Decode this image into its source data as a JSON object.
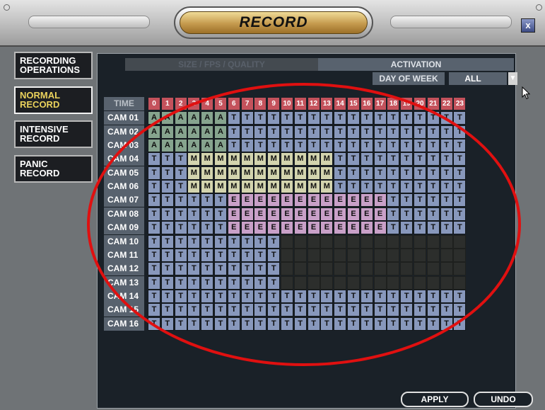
{
  "window": {
    "title": "RECORD",
    "close_label": "x"
  },
  "sidebar": {
    "items": [
      {
        "label": "RECORDING\nOPERATIONS",
        "active": false
      },
      {
        "label": "NORMAL\nRECORD",
        "active": true
      },
      {
        "label": "INTENSIVE\nRECORD",
        "active": false
      },
      {
        "label": "PANIC\nRECORD",
        "active": false
      }
    ]
  },
  "tabs": {
    "size_fps_quality": "SIZE / FPS / QUALITY",
    "activation": "ACTIVATION"
  },
  "day_of_week": {
    "label": "DAY OF WEEK",
    "value": "ALL"
  },
  "schedule": {
    "time_label": "TIME",
    "hours": [
      "0",
      "1",
      "2",
      "3",
      "4",
      "5",
      "6",
      "7",
      "8",
      "9",
      "10",
      "11",
      "12",
      "13",
      "14",
      "15",
      "16",
      "17",
      "18",
      "19",
      "20",
      "21",
      "22",
      "23"
    ],
    "rows": [
      {
        "camera": "CAM 01",
        "cells": "AAAAAATTTTTTTTTTTTTTTTTT"
      },
      {
        "camera": "CAM 02",
        "cells": "AAAAAATTTTTTTTTTTTTTTTTT"
      },
      {
        "camera": "CAM 03",
        "cells": "AAAAAATTTTTTTTTTTTTTTTTT"
      },
      {
        "camera": "CAM 04",
        "cells": "TTTMMMMMMMMMMMTTTTTTTTTT"
      },
      {
        "camera": "CAM 05",
        "cells": "TTTMMMMMMMMMMMTTTTTTTTTT"
      },
      {
        "camera": "CAM 06",
        "cells": "TTTMMMMMMMMMMMTTTTTTTTTT"
      },
      {
        "camera": "CAM 07",
        "cells": "TTTTTTEEEEEEEEEEEETTTTTT"
      },
      {
        "camera": "CAM 08",
        "cells": "TTTTTTEEEEEEEEEEEETTTTTT"
      },
      {
        "camera": "CAM 09",
        "cells": "TTTTTTEEEEEEEEEEEETTTTTT"
      },
      {
        "camera": "CAM 10",
        "cells": "TTTTTTTTTTNNNNNNNNNNNNNN"
      },
      {
        "camera": "CAM 11",
        "cells": "TTTTTTTTTTNNNNNNNNNNNNNN"
      },
      {
        "camera": "CAM 12",
        "cells": "TTTTTTTTTTNNNNNNNNNNNNNN"
      },
      {
        "camera": "CAM 13",
        "cells": "TTTTTTTTTTNNNNNNNNNNNNNN"
      },
      {
        "camera": "CAM 14",
        "cells": "TTTTTTTTTTTTTTTTTTTTTTTT"
      },
      {
        "camera": "CAM 15",
        "cells": "TTTTTTTTTTTTTTTTTTTTTTTT"
      },
      {
        "camera": "CAM 16",
        "cells": "TTTTTTTTTTTTTTTTTTTTTTTT"
      }
    ]
  },
  "buttons": {
    "apply": "APPLY",
    "undo": "UNDO"
  },
  "colors": {
    "time": "#8898bc",
    "alarm": "#86a48e",
    "motion": "#d3d4ae",
    "event": "#c9a0c8",
    "none": "#2c2e2c",
    "hour_header": "#c4525c",
    "annotation": "#e01010"
  }
}
